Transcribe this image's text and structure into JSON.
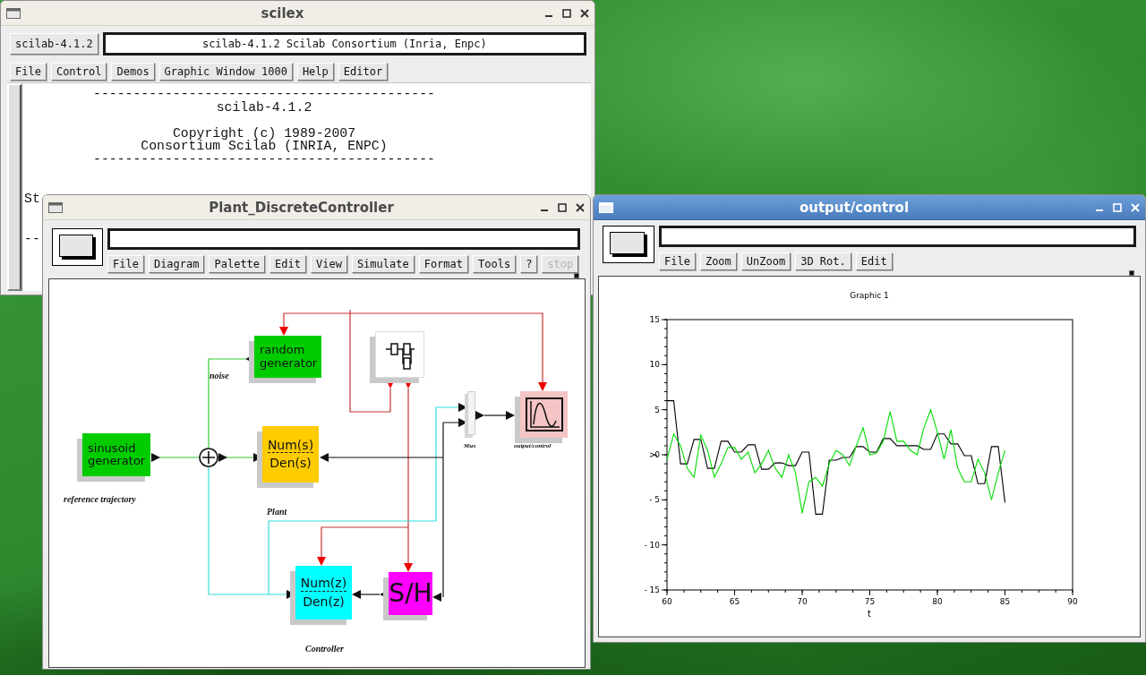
{
  "windows": [
    {
      "kind": "console",
      "title": "scilex",
      "active": false,
      "toolbar_button": "scilab-4.1.2",
      "message": "scilab-4.1.2 Scilab Consortium (Inria, Enpc)",
      "menu": [
        {
          "label": "File"
        },
        {
          "label": "Control"
        },
        {
          "label": "Demos"
        },
        {
          "label": "Graphic Window 1000"
        },
        {
          "label": "Help"
        },
        {
          "label": "Editor"
        }
      ],
      "banner": [
        [
          "-------------------------------------------",
          "scilab-4.1.2"
        ],
        [
          "Copyright (c) 1989-2007",
          "Consortium Scilab (INRIA, ENPC)",
          "-------------------------------------------"
        ]
      ],
      "console_lines": [
        "St",
        "--"
      ]
    },
    {
      "kind": "diagram",
      "title": "Plant_DiscreteController",
      "active": false,
      "menu": [
        {
          "label": "File",
          "disabled": false
        },
        {
          "label": "Diagram",
          "disabled": false
        },
        {
          "label": "Palette",
          "disabled": false
        },
        {
          "label": "Edit",
          "disabled": false
        },
        {
          "label": "View",
          "disabled": false
        },
        {
          "label": "Simulate",
          "disabled": false
        },
        {
          "label": "Format",
          "disabled": false
        },
        {
          "label": "Tools",
          "disabled": false
        },
        {
          "label": "?",
          "disabled": false
        },
        {
          "label": "stop",
          "disabled": true
        }
      ],
      "diagram": {
        "blocks": [
          {
            "kind": "text",
            "lines": [
              "random",
              "generator"
            ],
            "color": "#00cc00"
          },
          {
            "kind": "superblock"
          },
          {
            "kind": "text",
            "lines": [
              "sinusoid",
              "generator"
            ],
            "color": "#00cc00"
          },
          {
            "kind": "sum"
          },
          {
            "kind": "fraction",
            "numerator": "Num(s)",
            "denominator": "Den(s)",
            "color": "#ffcc00"
          },
          {
            "kind": "mux"
          },
          {
            "kind": "scope",
            "color": "#f5c4c4"
          },
          {
            "kind": "fraction",
            "numerator": "Num(z)",
            "denominator": "Den(z)",
            "color": "#00ffff"
          },
          {
            "kind": "text",
            "lines": [
              "S/H"
            ],
            "color": "#ff00ff"
          }
        ],
        "labels": [
          "noise",
          "reference trajectory",
          "Plant",
          "Mux",
          "output/control",
          "Controller"
        ]
      }
    },
    {
      "kind": "graphic",
      "title": "output/control",
      "active": true,
      "menu": [
        {
          "label": "File"
        },
        {
          "label": "Zoom"
        },
        {
          "label": "UnZoom"
        },
        {
          "label": "3D Rot."
        },
        {
          "label": "Edit"
        }
      ],
      "chart_data": {
        "type": "line",
        "title": "Graphic 1",
        "xlabel": "t",
        "ylabel": "y",
        "x": [
          60,
          60.5,
          61,
          61.5,
          62,
          62.5,
          63,
          63.5,
          64,
          64.5,
          65,
          65.5,
          66,
          66.5,
          67,
          67.5,
          68,
          68.5,
          69,
          69.5,
          70,
          70.5,
          71,
          71.5,
          72,
          72.5,
          73,
          73.5,
          74,
          74.5,
          75,
          75.5,
          76,
          76.5,
          77,
          77.5,
          78,
          78.5,
          79,
          79.5,
          80,
          80.5,
          81,
          81.5,
          82,
          82.5,
          83,
          83.5,
          84,
          84.5,
          85
        ],
        "series": [
          {
            "color": "#000000",
            "values": [
              6,
              6,
              -1,
              -1,
              1.7,
              1.7,
              -1.5,
              -1.5,
              1.5,
              1.5,
              0.3,
              0.3,
              1.1,
              1.1,
              -1.6,
              -1.6,
              -0.9,
              -0.9,
              -1.2,
              -1.2,
              0.3,
              0.3,
              -6.6,
              -6.6,
              -0.6,
              -0.6,
              -0.3,
              -0.3,
              0.9,
              0.9,
              0.3,
              0.3,
              1.8,
              1.8,
              1,
              1,
              1,
              1,
              0.6,
              0.6,
              2.3,
              2.3,
              1.2,
              1.2,
              -0.1,
              -0.1,
              -3.2,
              -3.2,
              0.9,
              0.9,
              -5.3
            ]
          },
          {
            "color": "#00dd00",
            "values": [
              -0.5,
              2.3,
              1,
              -1.5,
              -2.5,
              2.2,
              0.5,
              -2.5,
              -1,
              0.8,
              0.8,
              -0.5,
              0.3,
              -2,
              -1,
              0.5,
              -1.5,
              -2.5,
              0,
              -2,
              -6.5,
              -3,
              -2.5,
              -3.5,
              -1,
              0.5,
              0,
              -1.2,
              1,
              3,
              0,
              0.2,
              1.5,
              4.8,
              1.5,
              1.5,
              0.5,
              0,
              3,
              5,
              2.5,
              -0.5,
              2.8,
              -1.5,
              -3,
              -3,
              -0.5,
              -2,
              -5,
              -2,
              0.5
            ]
          }
        ],
        "xlim": [
          60,
          90
        ],
        "ylim": [
          -15,
          15
        ],
        "xticks": [
          60,
          65,
          70,
          75,
          80,
          85,
          90
        ],
        "yticks": [
          {
            "value": -15,
            "label": "- 15"
          },
          {
            "value": -10,
            "label": "- 10"
          },
          {
            "value": -5,
            "label": "- 5"
          },
          0,
          5,
          10,
          15
        ]
      }
    }
  ]
}
